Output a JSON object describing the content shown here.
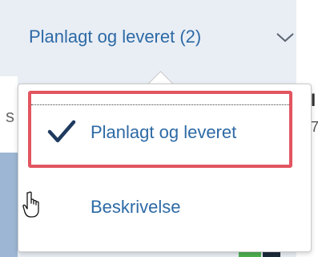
{
  "dropdown": {
    "label": "Planlagt og leveret (2)",
    "icon": "chevron-down-icon"
  },
  "background_peek": {
    "left_char": "s",
    "right_char_1": "I",
    "right_char_2": "7"
  },
  "menu": {
    "options": [
      {
        "label": "Planlagt og leveret",
        "selected": true,
        "icon": "checkmark-icon"
      },
      {
        "label": "Beskrivelse",
        "selected": false
      }
    ]
  },
  "colors": {
    "accent": "#2d6aa5",
    "highlight": "#e25560",
    "header_bg": "#e9eef5"
  }
}
